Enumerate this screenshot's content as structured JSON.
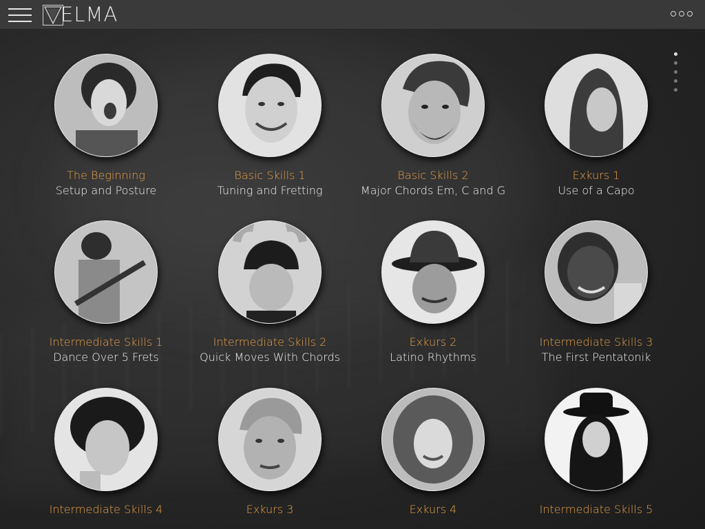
{
  "app": {
    "logo_text": "ELMA",
    "logo_icon": "velma-triangle-logo"
  },
  "header": {
    "menu_icon": "hamburger-menu-icon",
    "more_icon": "more-options-icon"
  },
  "pager": {
    "count": 5,
    "active_index": 0
  },
  "colors": {
    "title_accent": "#e9a24a",
    "subtitle": "#f1f1f1",
    "topbar": "#3c3c3c",
    "background": "#2a2a2a"
  },
  "lessons": [
    {
      "title": "The Beginning",
      "subtitle": "Setup and Posture",
      "photo_icon": "screaming-singer-portrait"
    },
    {
      "title": "Basic Skills 1",
      "subtitle": "Tuning and Fretting",
      "photo_icon": "smiling-man-pompadour-portrait"
    },
    {
      "title": "Basic Skills 2",
      "subtitle": "Major Chords Em, C and G",
      "photo_icon": "bearded-man-portrait"
    },
    {
      "title": "Exkurs 1",
      "subtitle": "Use of a Capo",
      "photo_icon": "long-hair-woman-portrait"
    },
    {
      "title": "Intermediate Skills 1",
      "subtitle": "Dance Over 5 Frets",
      "photo_icon": "guitarist-playing-portrait"
    },
    {
      "title": "Intermediate Skills 2",
      "subtitle": "Quick Moves With Chords",
      "photo_icon": "man-flat-cap-portrait"
    },
    {
      "title": "Exkurs 2",
      "subtitle": "Latino Rhythms",
      "photo_icon": "man-fedora-portrait"
    },
    {
      "title": "Intermediate Skills 3",
      "subtitle": "The First Pentatonik",
      "photo_icon": "man-with-guitar-portrait"
    },
    {
      "title": "Intermediate Skills 4",
      "subtitle": "",
      "photo_icon": "curly-hair-man-portrait"
    },
    {
      "title": "Exkurs 3",
      "subtitle": "",
      "photo_icon": "grey-hair-man-portrait"
    },
    {
      "title": "Exkurs 4",
      "subtitle": "",
      "photo_icon": "curly-hair-woman-portrait"
    },
    {
      "title": "Intermediate Skills 5",
      "subtitle": "",
      "photo_icon": "man-black-hat-portrait"
    }
  ]
}
